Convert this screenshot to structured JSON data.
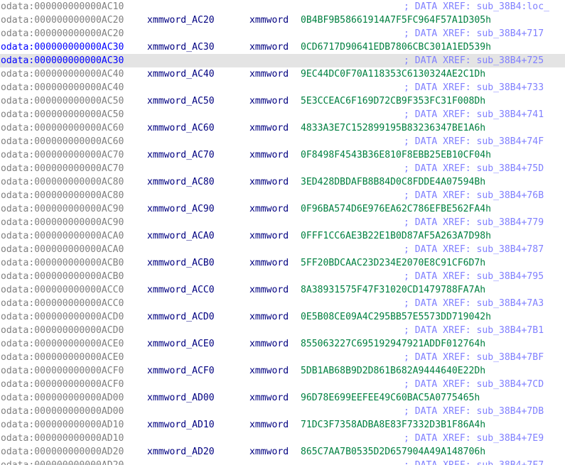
{
  "colors": {
    "background": "#ffffff",
    "address_gray": "#808080",
    "address_highlight": "#0000ff",
    "name_navy": "#000080",
    "value_green": "#008040",
    "comment_blue": "#8080ff",
    "current_line_bg": "#e4e4e4"
  },
  "rows": [
    {
      "address": "odata:000000000000AC10",
      "label": "",
      "type": "",
      "value": "",
      "xref": "; DATA XREF: sub_38B4:loc_"
    },
    {
      "address": "odata:000000000000AC20",
      "label": "xmmword_AC20",
      "type": "xmmword",
      "value": "0B4BF9B58661914A7F5FC964F57A1D305h",
      "xref": ""
    },
    {
      "address": "odata:000000000000AC20",
      "label": "",
      "type": "",
      "value": "",
      "xref": "; DATA XREF: sub_38B4+717"
    },
    {
      "address": "odata:000000000000AC30",
      "label": "xmmword_AC30",
      "type": "xmmword",
      "value": "0CD6717D90641EDB7806CBC301A1ED539h",
      "xref": ""
    },
    {
      "address": "odata:000000000000AC30",
      "label": "",
      "type": "",
      "value": "",
      "xref": "; DATA XREF: sub_38B4+725"
    },
    {
      "address": "odata:000000000000AC40",
      "label": "xmmword_AC40",
      "type": "xmmword",
      "value": "9EC44DC0F70A118353C6130324AE2C1Dh",
      "xref": ""
    },
    {
      "address": "odata:000000000000AC40",
      "label": "",
      "type": "",
      "value": "",
      "xref": "; DATA XREF: sub_38B4+733"
    },
    {
      "address": "odata:000000000000AC50",
      "label": "xmmword_AC50",
      "type": "xmmword",
      "value": "5E3CCEAC6F169D72CB9F353FC31F008Dh",
      "xref": ""
    },
    {
      "address": "odata:000000000000AC50",
      "label": "",
      "type": "",
      "value": "",
      "xref": "; DATA XREF: sub_38B4+741"
    },
    {
      "address": "odata:000000000000AC60",
      "label": "xmmword_AC60",
      "type": "xmmword",
      "value": "4833A3E7C152899195B83236347BE1A6h",
      "xref": ""
    },
    {
      "address": "odata:000000000000AC60",
      "label": "",
      "type": "",
      "value": "",
      "xref": "; DATA XREF: sub_38B4+74F"
    },
    {
      "address": "odata:000000000000AC70",
      "label": "xmmword_AC70",
      "type": "xmmword",
      "value": "0F8498F4543B36E810F8EBB25EB10CF04h",
      "xref": ""
    },
    {
      "address": "odata:000000000000AC70",
      "label": "",
      "type": "",
      "value": "",
      "xref": "; DATA XREF: sub_38B4+75D"
    },
    {
      "address": "odata:000000000000AC80",
      "label": "xmmword_AC80",
      "type": "xmmword",
      "value": "3ED428DBDAFB8B84D0C8FDDE4A07594Bh",
      "xref": ""
    },
    {
      "address": "odata:000000000000AC80",
      "label": "",
      "type": "",
      "value": "",
      "xref": "; DATA XREF: sub_38B4+76B"
    },
    {
      "address": "odata:000000000000AC90",
      "label": "xmmword_AC90",
      "type": "xmmword",
      "value": "0F96BA574D6E976EA62C786EFBE562FA4h",
      "xref": ""
    },
    {
      "address": "odata:000000000000AC90",
      "label": "",
      "type": "",
      "value": "",
      "xref": "; DATA XREF: sub_38B4+779"
    },
    {
      "address": "odata:000000000000ACA0",
      "label": "xmmword_ACA0",
      "type": "xmmword",
      "value": "0FFF1CC6AE3B22E1B0D87AF5A263A7D98h",
      "xref": ""
    },
    {
      "address": "odata:000000000000ACA0",
      "label": "",
      "type": "",
      "value": "",
      "xref": "; DATA XREF: sub_38B4+787"
    },
    {
      "address": "odata:000000000000ACB0",
      "label": "xmmword_ACB0",
      "type": "xmmword",
      "value": "5FF20BDCAAC23D234E2070E8C91CF6D7h",
      "xref": ""
    },
    {
      "address": "odata:000000000000ACB0",
      "label": "",
      "type": "",
      "value": "",
      "xref": "; DATA XREF: sub_38B4+795"
    },
    {
      "address": "odata:000000000000ACC0",
      "label": "xmmword_ACC0",
      "type": "xmmword",
      "value": "8A38931575F47F31020CD1479788FA7Ah",
      "xref": ""
    },
    {
      "address": "odata:000000000000ACC0",
      "label": "",
      "type": "",
      "value": "",
      "xref": "; DATA XREF: sub_38B4+7A3"
    },
    {
      "address": "odata:000000000000ACD0",
      "label": "xmmword_ACD0",
      "type": "xmmword",
      "value": "0E5B08CE09A4C295BB57E5573DD719042h",
      "xref": ""
    },
    {
      "address": "odata:000000000000ACD0",
      "label": "",
      "type": "",
      "value": "",
      "xref": "; DATA XREF: sub_38B4+7B1"
    },
    {
      "address": "odata:000000000000ACE0",
      "label": "xmmword_ACE0",
      "type": "xmmword",
      "value": "855063227C695192947921ADDF012764h",
      "xref": ""
    },
    {
      "address": "odata:000000000000ACE0",
      "label": "",
      "type": "",
      "value": "",
      "xref": "; DATA XREF: sub_38B4+7BF"
    },
    {
      "address": "odata:000000000000ACF0",
      "label": "xmmword_ACF0",
      "type": "xmmword",
      "value": "5DB1AB68B9D2D861B682A9444640E22Dh",
      "xref": ""
    },
    {
      "address": "odata:000000000000ACF0",
      "label": "",
      "type": "",
      "value": "",
      "xref": "; DATA XREF: sub_38B4+7CD"
    },
    {
      "address": "odata:000000000000AD00",
      "label": "xmmword_AD00",
      "type": "xmmword",
      "value": "96D78E699EEFEE49C60BAC5A0775465h",
      "xref": ""
    },
    {
      "address": "odata:000000000000AD00",
      "label": "",
      "type": "",
      "value": "",
      "xref": "; DATA XREF: sub_38B4+7DB"
    },
    {
      "address": "odata:000000000000AD10",
      "label": "xmmword_AD10",
      "type": "xmmword",
      "value": "71DC3F7358ADBA8E83F7332D3B1F86A4h",
      "xref": ""
    },
    {
      "address": "odata:000000000000AD10",
      "label": "",
      "type": "",
      "value": "",
      "xref": "; DATA XREF: sub_38B4+7E9"
    },
    {
      "address": "odata:000000000000AD20",
      "label": "xmmword_AD20",
      "type": "xmmword",
      "value": "865C7AA7B0535D2D657904A49A148706h",
      "xref": ""
    },
    {
      "address": "odata:000000000000AD20",
      "label": "",
      "type": "",
      "value": "",
      "xref": "; DATA XREF: sub_38B4+7F7"
    }
  ],
  "highlighted_row": 3,
  "current_row": 4
}
